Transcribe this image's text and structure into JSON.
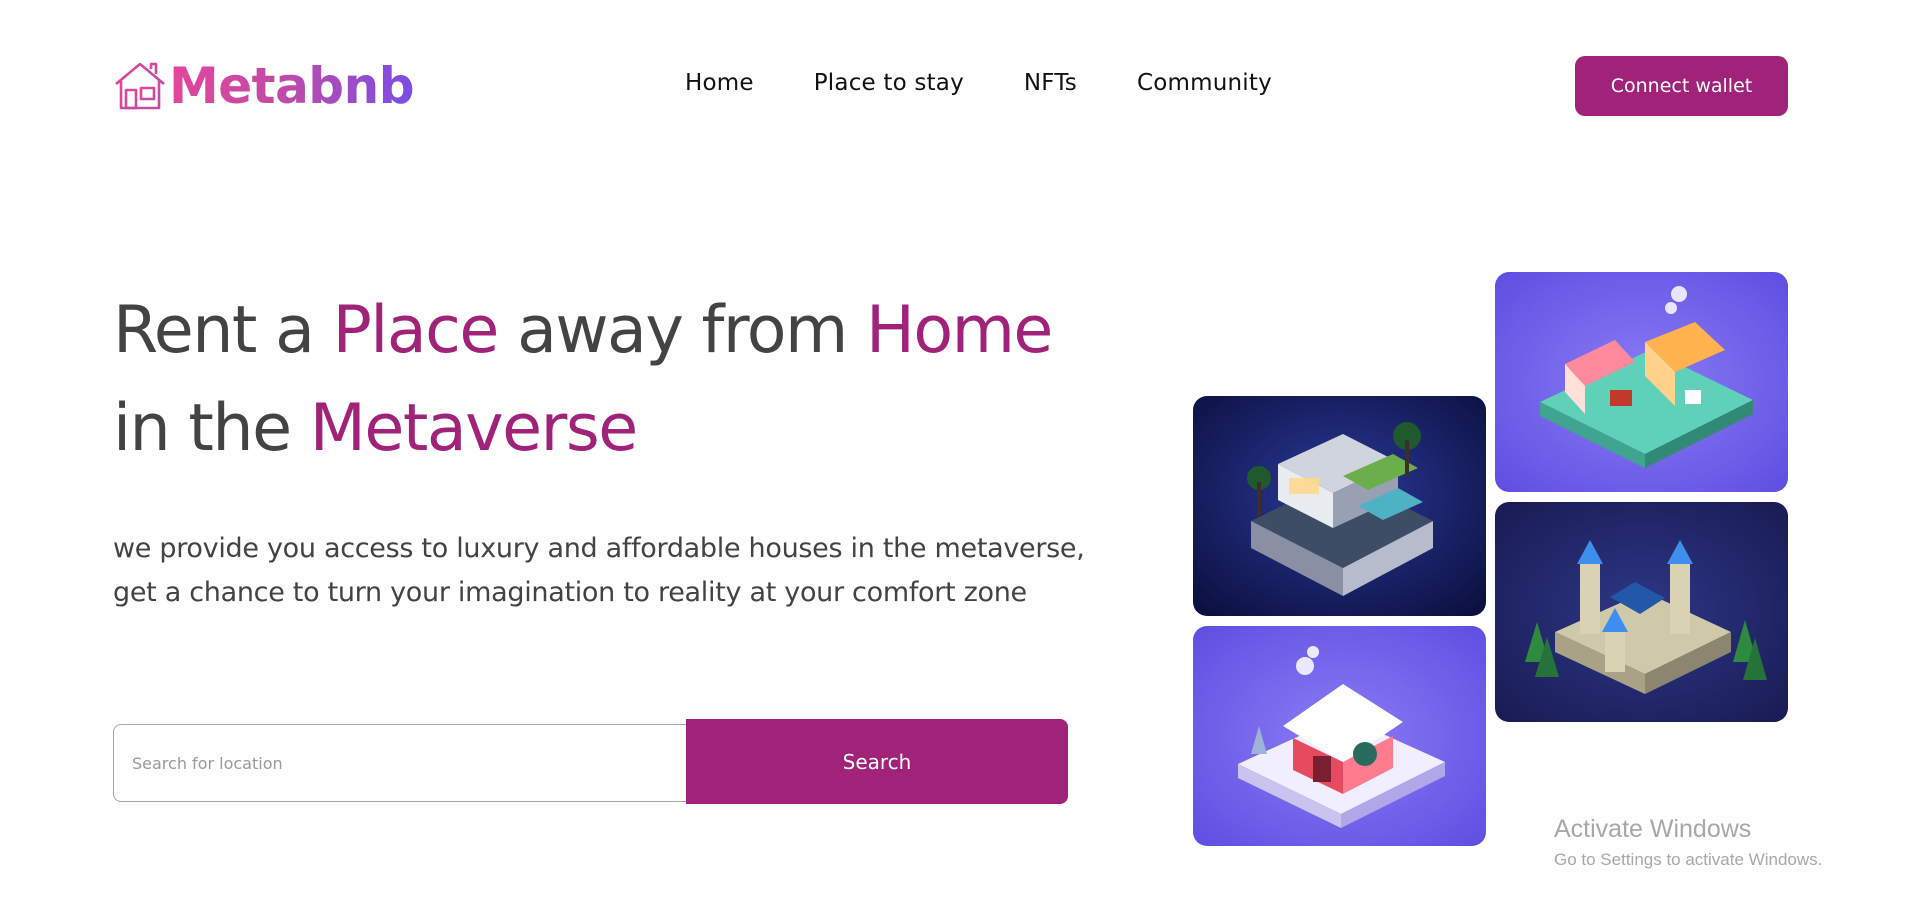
{
  "brand": {
    "name": "Metabnb",
    "logo_icon": "house-icon",
    "gradient": [
      "#e4469b",
      "#7a4de6"
    ]
  },
  "nav": {
    "items": [
      {
        "label": "Home"
      },
      {
        "label": "Place to stay"
      },
      {
        "label": "NFTs"
      },
      {
        "label": "Community"
      }
    ]
  },
  "header": {
    "connect_label": "Connect wallet"
  },
  "hero": {
    "line1": {
      "a": "Rent a ",
      "b": "Place",
      "c": " away from ",
      "d": "Home"
    },
    "line2": {
      "a": "in the ",
      "b": "Metaverse"
    },
    "subtitle": "we provide you access to luxury and affordable houses in the metaverse, get a chance to turn your imagination to reality at your comfort zone"
  },
  "search": {
    "placeholder": "Search for location",
    "button_label": "Search"
  },
  "gallery": [
    {
      "name": "villa-image"
    },
    {
      "name": "market-stall-image"
    },
    {
      "name": "castle-image"
    },
    {
      "name": "winter-house-image"
    }
  ],
  "watermark": {
    "title": "Activate Windows",
    "subtitle": "Go to Settings to activate Windows."
  },
  "colors": {
    "accent": "#a02279",
    "text": "#434343",
    "nav_text": "#111111",
    "card_purple": "#7b5cf0",
    "card_navy": "#1c2060"
  }
}
